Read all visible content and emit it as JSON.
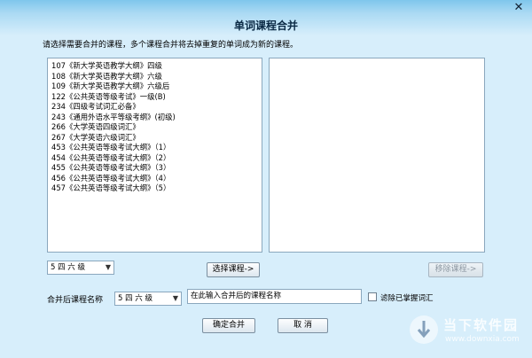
{
  "window": {
    "title": "单词课程合并",
    "close_label": "✕"
  },
  "instruction": "请选择需要合并的课程，多个课程合并将去掉重复的单词成为新的课程。",
  "course_list": [
    "107《新大学英语教学大纲》四级",
    "108《新大学英语教学大纲》六级",
    "109《新大学英语教学大纲》六级后",
    "122《公共英语等级考试》一级(B)",
    "234《四级考试词汇必备》",
    "243《通用外语水平等级考纲》(初级)",
    "266《大学英语四级词汇》",
    "267《大学英语六级词汇》",
    "453《公共英语等级考试大纲》（1）",
    "454《公共英语等级考试大纲》（2）",
    "455《公共英语等级考试大纲》（3）",
    "456《公共英语等级考试大纲》（4）",
    "457《公共英语等级考试大纲》（5）"
  ],
  "selected_list": [],
  "level_select_top": {
    "value": "5 四 六 级"
  },
  "buttons": {
    "select_course": "选择课程->",
    "remove_course": "移除课程->",
    "confirm_merge": "确定合并",
    "cancel": "取 消"
  },
  "merge": {
    "label": "合并后课程名称",
    "level_value": "5 四 六 级",
    "name_value": "在此输入合并后的课程名称",
    "filter_label": "滤除已掌握词汇"
  },
  "watermark": {
    "title": "当下软件园",
    "url": "www.downxia.com"
  }
}
